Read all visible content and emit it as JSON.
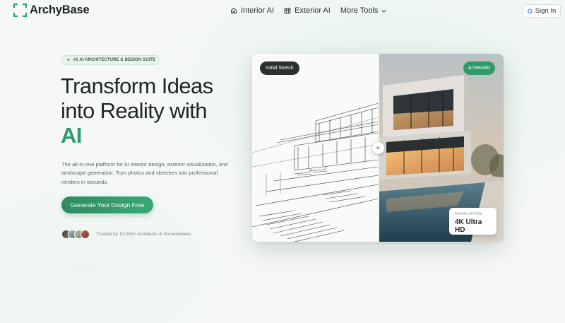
{
  "brand": {
    "name": "ArchyBase",
    "accent_color": "#2e9b68"
  },
  "nav": {
    "links": [
      {
        "label": "Interior AI",
        "icon": "home-icon"
      },
      {
        "label": "Exterior AI",
        "icon": "building-icon"
      },
      {
        "label": "More Tools",
        "icon": "chevron-down-icon"
      }
    ],
    "signin": {
      "label": "Sign In",
      "icon": "google-icon"
    }
  },
  "hero": {
    "badge": "#1 AI ARCHITECTURE & DESIGN SUITE",
    "headline_line1": "Transform Ideas",
    "headline_line2": "into Reality with",
    "headline_accent": "AI",
    "description": "The all-in-one platform for AI interior design, exterior visualization, and landscape generation. Turn photos and sketches into professional renders in seconds.",
    "cta_label": "Generate Your Design Free",
    "trust_text": "Trusted by 10,000+ Architects & Homeowners"
  },
  "compare": {
    "left_label": "Initial Sketch",
    "right_label": "Ai Render",
    "resolution_label": "RESOLUTION",
    "resolution_value": "4K Ultra HD"
  }
}
